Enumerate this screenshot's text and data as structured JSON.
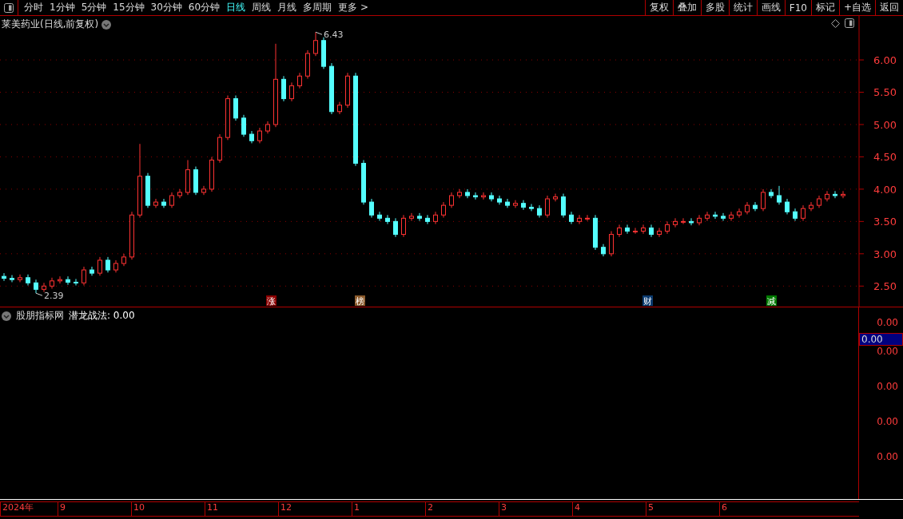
{
  "toolbar": {
    "tabs": [
      {
        "label": "分时",
        "selected": false
      },
      {
        "label": "1分钟",
        "selected": false
      },
      {
        "label": "5分钟",
        "selected": false
      },
      {
        "label": "15分钟",
        "selected": false
      },
      {
        "label": "30分钟",
        "selected": false
      },
      {
        "label": "60分钟",
        "selected": false
      },
      {
        "label": "日线",
        "selected": true
      },
      {
        "label": "周线",
        "selected": false
      },
      {
        "label": "月线",
        "selected": false
      },
      {
        "label": "多周期",
        "selected": false
      },
      {
        "label": "更多 >",
        "selected": false
      }
    ],
    "buttons": [
      "复权",
      "叠加",
      "多股",
      "统计",
      "画线",
      "F10",
      "标记",
      "+自选",
      "返回"
    ]
  },
  "main_chart": {
    "title": "莱美药业(日线,前复权)",
    "chart_data": {
      "type": "candlestick",
      "grid": true,
      "ylim": [
        2.17,
        6.68
      ],
      "yticks": [
        {
          "value": 6,
          "label": "6.00"
        },
        {
          "value": 5.5,
          "label": "5.50"
        },
        {
          "value": 5,
          "label": "5.00"
        },
        {
          "value": 4.5,
          "label": "4.50"
        },
        {
          "value": 4,
          "label": "4.00"
        },
        {
          "value": 3.5,
          "label": "3.50"
        },
        {
          "value": 3,
          "label": "3.00"
        },
        {
          "value": 2.5,
          "label": "2.50"
        }
      ],
      "ohlc": [
        [
          2.65,
          2.7,
          2.58,
          2.62
        ],
        [
          2.62,
          2.67,
          2.56,
          2.6
        ],
        [
          2.6,
          2.68,
          2.56,
          2.63
        ],
        [
          2.63,
          2.68,
          2.51,
          2.55
        ],
        [
          2.55,
          2.6,
          2.39,
          2.45
        ],
        [
          2.45,
          2.55,
          2.41,
          2.5
        ],
        [
          2.5,
          2.63,
          2.46,
          2.58
        ],
        [
          2.58,
          2.65,
          2.54,
          2.6
        ],
        [
          2.6,
          2.65,
          2.52,
          2.56
        ],
        [
          2.56,
          2.61,
          2.51,
          2.55
        ],
        [
          2.55,
          2.8,
          2.51,
          2.75
        ],
        [
          2.75,
          2.8,
          2.66,
          2.7
        ],
        [
          2.7,
          2.95,
          2.66,
          2.9
        ],
        [
          2.9,
          2.95,
          2.71,
          2.75
        ],
        [
          2.75,
          2.9,
          2.71,
          2.85
        ],
        [
          2.85,
          3.0,
          2.81,
          2.95
        ],
        [
          2.95,
          3.65,
          2.91,
          3.6
        ],
        [
          3.6,
          4.7,
          3.56,
          4.2
        ],
        [
          4.2,
          4.25,
          3.71,
          3.75
        ],
        [
          3.75,
          3.85,
          3.71,
          3.8
        ],
        [
          3.8,
          3.85,
          3.71,
          3.75
        ],
        [
          3.75,
          3.95,
          3.71,
          3.9
        ],
        [
          3.9,
          4.0,
          3.86,
          3.95
        ],
        [
          3.95,
          4.45,
          3.91,
          4.3
        ],
        [
          4.3,
          4.35,
          3.91,
          3.95
        ],
        [
          3.95,
          4.05,
          3.91,
          4.0
        ],
        [
          4.0,
          4.5,
          3.96,
          4.45
        ],
        [
          4.45,
          4.85,
          4.41,
          4.8
        ],
        [
          4.8,
          5.45,
          4.76,
          5.4
        ],
        [
          5.4,
          5.45,
          5.06,
          5.1
        ],
        [
          5.1,
          5.15,
          4.81,
          4.85
        ],
        [
          4.85,
          4.9,
          4.71,
          4.75
        ],
        [
          4.75,
          4.95,
          4.71,
          4.9
        ],
        [
          4.9,
          5.05,
          4.86,
          5.0
        ],
        [
          5.0,
          6.25,
          4.96,
          5.7
        ],
        [
          5.7,
          5.75,
          5.36,
          5.4
        ],
        [
          5.4,
          5.65,
          5.36,
          5.6
        ],
        [
          5.6,
          5.8,
          5.56,
          5.75
        ],
        [
          5.75,
          6.15,
          5.71,
          6.1
        ],
        [
          6.1,
          6.43,
          6.06,
          6.3
        ],
        [
          6.3,
          6.35,
          5.86,
          5.9
        ],
        [
          5.9,
          5.95,
          5.16,
          5.2
        ],
        [
          5.2,
          5.35,
          5.16,
          5.3
        ],
        [
          5.3,
          5.8,
          5.26,
          5.75
        ],
        [
          5.75,
          5.8,
          4.36,
          4.4
        ],
        [
          4.4,
          4.45,
          3.76,
          3.8
        ],
        [
          3.8,
          3.85,
          3.56,
          3.6
        ],
        [
          3.6,
          3.65,
          3.51,
          3.55
        ],
        [
          3.55,
          3.6,
          3.46,
          3.5
        ],
        [
          3.5,
          3.55,
          3.26,
          3.3
        ],
        [
          3.3,
          3.6,
          3.26,
          3.55
        ],
        [
          3.55,
          3.63,
          3.51,
          3.58
        ],
        [
          3.58,
          3.63,
          3.51,
          3.55
        ],
        [
          3.55,
          3.6,
          3.46,
          3.5
        ],
        [
          3.5,
          3.65,
          3.46,
          3.6
        ],
        [
          3.6,
          3.8,
          3.56,
          3.75
        ],
        [
          3.75,
          3.95,
          3.71,
          3.9
        ],
        [
          3.9,
          4.0,
          3.86,
          3.95
        ],
        [
          3.95,
          4.0,
          3.86,
          3.9
        ],
        [
          3.9,
          3.95,
          3.84,
          3.88
        ],
        [
          3.88,
          3.95,
          3.84,
          3.9
        ],
        [
          3.9,
          3.95,
          3.81,
          3.85
        ],
        [
          3.85,
          3.9,
          3.76,
          3.8
        ],
        [
          3.8,
          3.85,
          3.71,
          3.75
        ],
        [
          3.75,
          3.83,
          3.71,
          3.78
        ],
        [
          3.78,
          3.83,
          3.68,
          3.72
        ],
        [
          3.72,
          3.77,
          3.66,
          3.7
        ],
        [
          3.7,
          3.75,
          3.56,
          3.6
        ],
        [
          3.6,
          3.9,
          3.56,
          3.85
        ],
        [
          3.85,
          3.93,
          3.81,
          3.88
        ],
        [
          3.88,
          3.93,
          3.56,
          3.6
        ],
        [
          3.6,
          3.65,
          3.46,
          3.5
        ],
        [
          3.5,
          3.6,
          3.46,
          3.55
        ],
        [
          3.55,
          3.6,
          3.51,
          3.55
        ],
        [
          3.55,
          3.6,
          3.06,
          3.1
        ],
        [
          3.1,
          3.15,
          2.96,
          3.0
        ],
        [
          3.0,
          3.35,
          2.96,
          3.3
        ],
        [
          3.3,
          3.45,
          3.26,
          3.4
        ],
        [
          3.4,
          3.45,
          3.31,
          3.35
        ],
        [
          3.35,
          3.4,
          3.31,
          3.35
        ],
        [
          3.35,
          3.45,
          3.31,
          3.4
        ],
        [
          3.4,
          3.45,
          3.26,
          3.3
        ],
        [
          3.3,
          3.4,
          3.26,
          3.35
        ],
        [
          3.35,
          3.5,
          3.31,
          3.45
        ],
        [
          3.45,
          3.55,
          3.41,
          3.5
        ],
        [
          3.5,
          3.55,
          3.46,
          3.5
        ],
        [
          3.5,
          3.55,
          3.44,
          3.48
        ],
        [
          3.48,
          3.6,
          3.44,
          3.55
        ],
        [
          3.55,
          3.65,
          3.51,
          3.6
        ],
        [
          3.6,
          3.65,
          3.54,
          3.58
        ],
        [
          3.58,
          3.63,
          3.51,
          3.55
        ],
        [
          3.55,
          3.65,
          3.51,
          3.6
        ],
        [
          3.6,
          3.7,
          3.56,
          3.65
        ],
        [
          3.65,
          3.8,
          3.61,
          3.75
        ],
        [
          3.75,
          3.8,
          3.66,
          3.7
        ],
        [
          3.7,
          4.0,
          3.66,
          3.95
        ],
        [
          3.95,
          4.0,
          3.86,
          3.9
        ],
        [
          3.9,
          4.05,
          3.76,
          3.8
        ],
        [
          3.8,
          3.85,
          3.61,
          3.65
        ],
        [
          3.65,
          3.7,
          3.51,
          3.55
        ],
        [
          3.55,
          3.75,
          3.51,
          3.7
        ],
        [
          3.7,
          3.8,
          3.66,
          3.75
        ],
        [
          3.75,
          3.9,
          3.71,
          3.85
        ],
        [
          3.85,
          3.97,
          3.81,
          3.92
        ],
        [
          3.92,
          3.97,
          3.86,
          3.9
        ],
        [
          3.9,
          3.97,
          3.86,
          3.92
        ]
      ],
      "annotations": [
        "6.43",
        "2.39"
      ]
    },
    "event_badges": [
      {
        "text": "涨",
        "color": "#8b0000"
      },
      {
        "text": "榜",
        "color": "#8b5a2b"
      },
      {
        "text": "财",
        "color": "#0a3a6e"
      },
      {
        "text": "减",
        "color": "#007a00"
      }
    ]
  },
  "date_axis": [
    "2024年",
    "9",
    "10",
    "11",
    "12",
    "1",
    "2",
    "3",
    "4",
    "5",
    "6"
  ],
  "indicator": {
    "source": "股朋指标网",
    "reading": "潜龙战法: 0.00",
    "axis_labels": [
      "0.00",
      "0.00",
      "0.00",
      "0.00",
      "0.00"
    ],
    "current_value": "0.00"
  }
}
